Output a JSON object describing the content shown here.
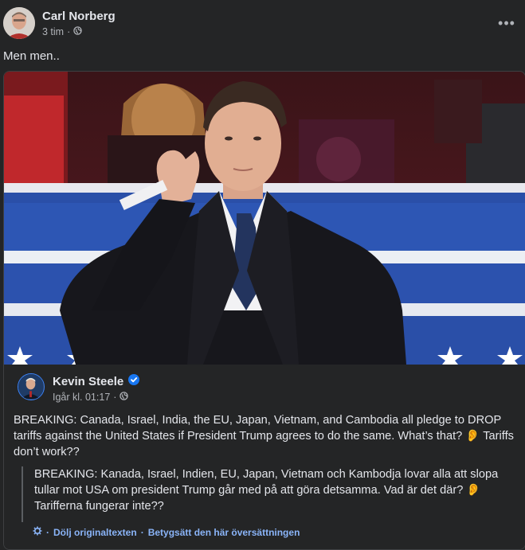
{
  "post": {
    "author": "Carl Norberg",
    "time": "3 tim",
    "separator": "·",
    "more_label": "•••",
    "caption": "Men men.."
  },
  "shared": {
    "author": "Kevin Steele",
    "time": "Igår kl. 01:17",
    "separator": "·",
    "text": "BREAKING: Canada, Israel, India, the EU, Japan, Vietnam, and Cambodia all pledge to DROP tariffs against the United States if President Trump agrees to do the same. What’s that? 👂 Tariffs don’t work??",
    "translation": "BREAKING: Kanada, Israel, Indien, EU, Japan, Vietnam och Kambodja lovar alla att slopa tullar mot USA om president Trump går med på att göra detsamma. Vad är det där? 👂 Tarifferna fungerar inte??",
    "hide_original": "Dölj originaltexten",
    "rate_translation": "Betygsätt den här översättningen",
    "link_separator": "·"
  },
  "colors": {
    "background": "#242526",
    "text": "#e4e6eb",
    "secondary": "#b0b3b8",
    "link": "#8ab4f8",
    "verified": "#1877f2"
  }
}
